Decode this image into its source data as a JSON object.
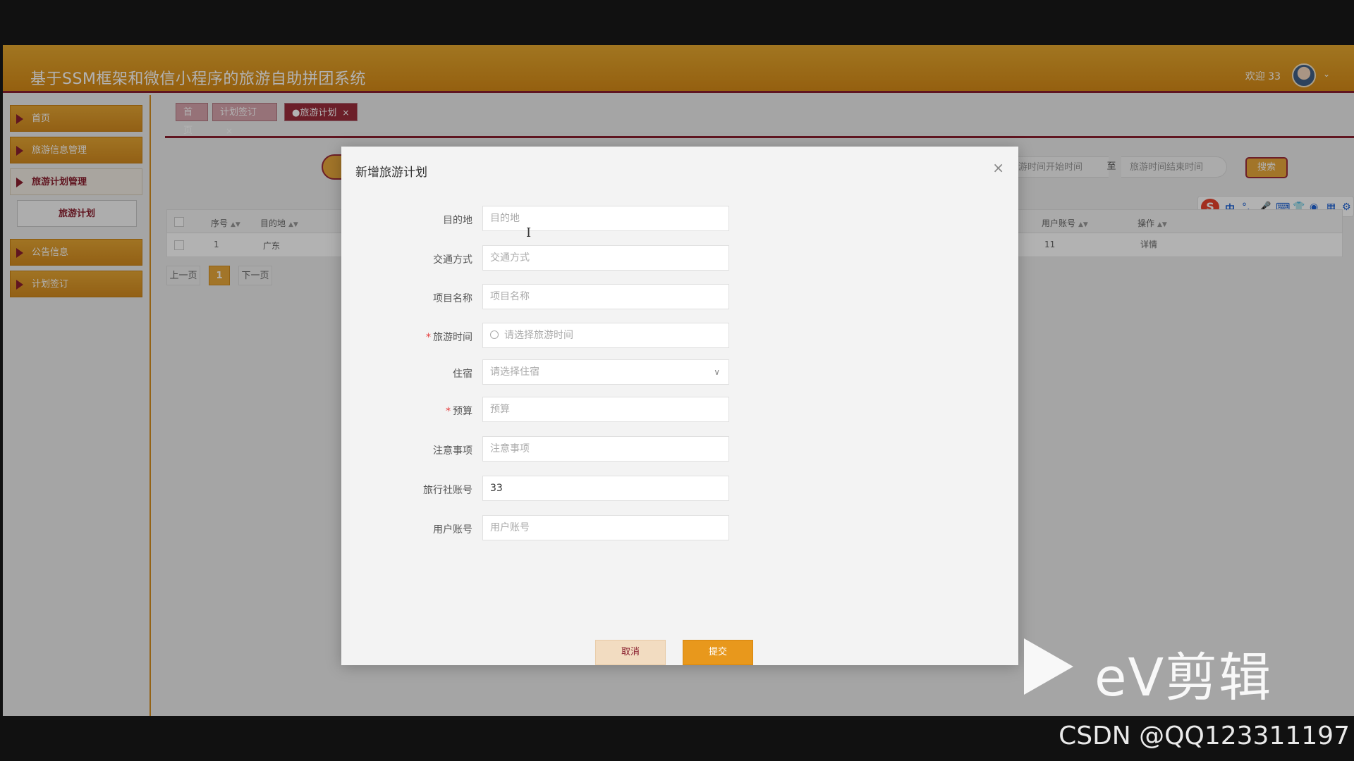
{
  "header": {
    "title": "基于SSM框架和微信小程序的旅游自助拼团系统",
    "welcome": "欢迎 33"
  },
  "sidebar": {
    "items": [
      {
        "label": "首页"
      },
      {
        "label": "旅游信息管理"
      },
      {
        "label": "旅游计划管理"
      },
      {
        "label": "公告信息"
      },
      {
        "label": "计划签订"
      }
    ],
    "sub_item": "旅游计划"
  },
  "tabs": [
    {
      "label": "首页"
    },
    {
      "label": "计划签订"
    },
    {
      "label": "●旅游计划"
    }
  ],
  "search": {
    "start_placeholder": "旅游时间开始时间",
    "to_label": "至",
    "end_placeholder": "旅游时间结束时间",
    "button": "搜索"
  },
  "table": {
    "headers": [
      "序号",
      "目的地",
      "用户账号",
      "操作"
    ],
    "row": {
      "index": "1",
      "destination": "广东",
      "user_account": "11",
      "action": "详情"
    }
  },
  "pager": {
    "prev": "上一页",
    "current": "1",
    "next": "下一页"
  },
  "ime": {
    "mode": "中"
  },
  "dialog": {
    "title": "新增旅游计划",
    "fields": [
      {
        "label": "目的地",
        "placeholder": "目的地",
        "required": false
      },
      {
        "label": "交通方式",
        "placeholder": "交通方式",
        "required": false
      },
      {
        "label": "项目名称",
        "placeholder": "项目名称",
        "required": false
      },
      {
        "label": "旅游时间",
        "placeholder": "请选择旅游时间",
        "required": true
      },
      {
        "label": "住宿",
        "placeholder": "请选择住宿",
        "required": false
      },
      {
        "label": "预算",
        "placeholder": "预算",
        "required": true
      },
      {
        "label": "注意事项",
        "placeholder": "注意事项",
        "required": false
      },
      {
        "label": "旅行社账号",
        "value": "33",
        "required": false
      },
      {
        "label": "用户账号",
        "placeholder": "用户账号",
        "required": false
      }
    ],
    "cancel": "取消",
    "submit": "提交"
  },
  "watermark": {
    "ev": "eV剪辑",
    "csdn": "CSDN @QQ123311197"
  }
}
